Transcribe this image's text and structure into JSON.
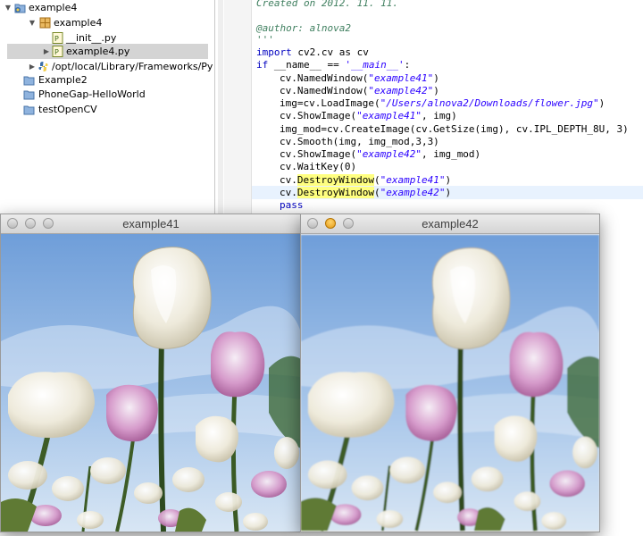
{
  "project_tree": {
    "items": [
      {
        "label": "example4",
        "icon": "python-project-icon",
        "twisty": "expanded",
        "selected": false
      },
      {
        "label": "example4",
        "icon": "package-icon",
        "twisty": "expanded",
        "selected": false
      },
      {
        "label": "__init__.py",
        "icon": "python-file-icon",
        "twisty": "",
        "selected": false
      },
      {
        "label": "example4.py",
        "icon": "python-file-icon",
        "twisty": "collapsed",
        "selected": true
      },
      {
        "label": "/opt/local/Library/Frameworks/Py",
        "icon": "python-interpreter-icon",
        "twisty": "collapsed",
        "selected": false
      },
      {
        "label": "Example2",
        "icon": "project-folder-icon",
        "twisty": "",
        "selected": false
      },
      {
        "label": "PhoneGap-HelloWorld",
        "icon": "project-folder-icon",
        "twisty": "",
        "selected": false
      },
      {
        "label": "testOpenCV",
        "icon": "project-folder-icon",
        "twisty": "",
        "selected": false
      }
    ]
  },
  "editor": {
    "created_comment": "Created on 2012. 11. 11.",
    "author_comment": "@author: alnova2",
    "docstring_close": "'''",
    "import_kw": "import",
    "import_rest": " cv2.cv as cv",
    "if_kw": "if",
    "if_rest": " __name__ == ",
    "main_str": "'__main__'",
    "colon": ":",
    "l_named1_a": "cv.NamedWindow(",
    "s_ex41": "\"example41\"",
    "close_paren": ")",
    "l_named2_a": "cv.NamedWindow(",
    "s_ex42": "\"example42\"",
    "l_load_a": "img=cv.LoadImage(",
    "s_path": "\"/Users/alnova2/Downloads/flower.jpg\"",
    "l_show1_a": "cv.ShowImage(",
    "l_show1_b": ", img)",
    "l_create": "img_mod=cv.CreateImage(cv.GetSize(img), cv.IPL_DEPTH_8U, 3)",
    "l_smooth": "cv.Smooth(img, img_mod,3,3)",
    "l_show2_a": "cv.ShowImage(",
    "l_show2_b": ", img_mod)",
    "l_wait": "cv.WaitKey(0)",
    "cv_prefix": "cv.",
    "destroy": "DestroyWindow",
    "open_paren": "(",
    "pass_kw": "pass"
  },
  "windows": [
    {
      "title": "example41",
      "active": false
    },
    {
      "title": "example42",
      "active": true
    }
  ],
  "colors": {
    "keyword": "#0000c0",
    "string": "#2a00ff",
    "comment": "#3f7f5f",
    "occurrence_highlight": "#ffff80",
    "current_line": "#e8f2fe",
    "selected_row": "#d4d4d4"
  }
}
